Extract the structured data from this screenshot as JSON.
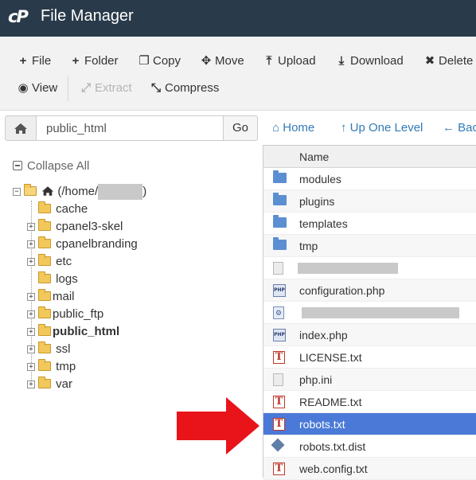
{
  "header": {
    "logo": "cP",
    "title": "File Manager"
  },
  "toolbar": {
    "file": "File",
    "folder": "Folder",
    "copy": "Copy",
    "move": "Move",
    "upload": "Upload",
    "download": "Download",
    "delete": "Delete",
    "view": "View",
    "extract": "Extract",
    "compress": "Compress"
  },
  "pathbar": {
    "path": "public_html",
    "go": "Go"
  },
  "nav": {
    "home": "Home",
    "up": "Up One Level",
    "back": "Back"
  },
  "tree": {
    "collapse_all": "Collapse All",
    "root_prefix": "(/home/",
    "root_suffix": ")",
    "items": [
      {
        "label": "cache"
      },
      {
        "label": "cpanel3-skel"
      },
      {
        "label": "cpanelbranding"
      },
      {
        "label": "etc"
      },
      {
        "label": "logs"
      },
      {
        "label": "mail"
      },
      {
        "label": "public_ftp"
      },
      {
        "label": "public_html"
      },
      {
        "label": "ssl"
      },
      {
        "label": "tmp"
      },
      {
        "label": "var"
      }
    ]
  },
  "files": {
    "header": "Name",
    "rows": [
      {
        "name": "modules",
        "icon": "folder-icon"
      },
      {
        "name": "plugins",
        "icon": "folder-icon"
      },
      {
        "name": "templates",
        "icon": "folder-icon"
      },
      {
        "name": "tmp",
        "icon": "folder-icon"
      },
      {
        "name": "",
        "icon": "document-icon"
      },
      {
        "name": "configuration.php",
        "icon": "php-file-icon"
      },
      {
        "name": "",
        "icon": "php-file-icon"
      },
      {
        "name": "index.php",
        "icon": "php-file-icon"
      },
      {
        "name": "LICENSE.txt",
        "icon": "text-file-icon"
      },
      {
        "name": "php.ini",
        "icon": "document-icon"
      },
      {
        "name": "README.txt",
        "icon": "text-file-icon"
      },
      {
        "name": "robots.txt",
        "icon": "text-file-icon",
        "selected": true
      },
      {
        "name": "robots.txt.dist",
        "icon": "dist-file-icon"
      },
      {
        "name": "web.config.txt",
        "icon": "text-file-icon"
      }
    ]
  },
  "colors": {
    "header_bg": "#293a4a",
    "selected_row": "#4a79d8",
    "link": "#337ab7",
    "arrow": "#e8141a"
  }
}
